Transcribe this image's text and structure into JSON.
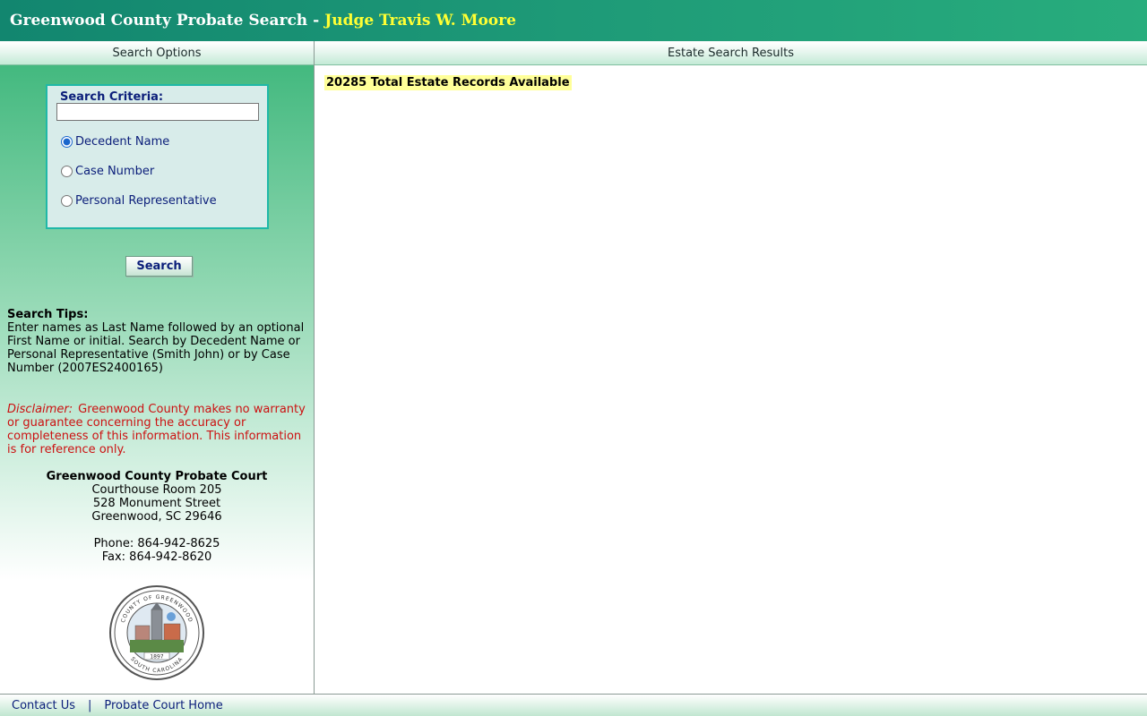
{
  "header": {
    "title": "Greenwood County Probate Search",
    "separator": "-",
    "judge": "Judge Travis W. Moore"
  },
  "columns": {
    "left": "Search Options",
    "right": "Estate Search Results"
  },
  "search": {
    "criteria_label": "Search Criteria:",
    "input_value": "",
    "options": [
      {
        "label": "Decedent Name",
        "checked": true
      },
      {
        "label": "Case Number",
        "checked": false
      },
      {
        "label": "Personal Representative",
        "checked": false
      }
    ],
    "button_label": "Search"
  },
  "tips": {
    "title": "Search Tips:",
    "body": "Enter names as Last Name followed by an optional First Name or initial. Search by Decedent Name or Personal Representative (Smith John) or by Case Number (2007ES2400165)"
  },
  "disclaimer": {
    "label": "Disclaimer:",
    "body": "Greenwood County makes no warranty or guarantee concerning the accuracy or completeness of this information. This information is for reference only."
  },
  "court": {
    "name": "Greenwood County Probate Court",
    "line1": "Courthouse Room 205",
    "line2": "528 Monument Street",
    "line3": "Greenwood, SC 29646",
    "phone": "Phone: 864-942-8625",
    "fax": "Fax: 864-942-8620"
  },
  "seal": {
    "top_text": "COUNTY OF GREENWOOD",
    "bottom_text": "SOUTH CAROLINA",
    "year": "1897"
  },
  "results": {
    "records_text": "20285 Total Estate Records Available"
  },
  "footer": {
    "contact": "Contact Us",
    "separator": "|",
    "home": "Probate Court Home"
  },
  "colors": {
    "header_green": "#1f9c78",
    "judge_yellow": "#ffff33",
    "link_blue": "#0b1e7a",
    "disclaimer_red": "#cc1111",
    "highlight": "#ffff99"
  }
}
